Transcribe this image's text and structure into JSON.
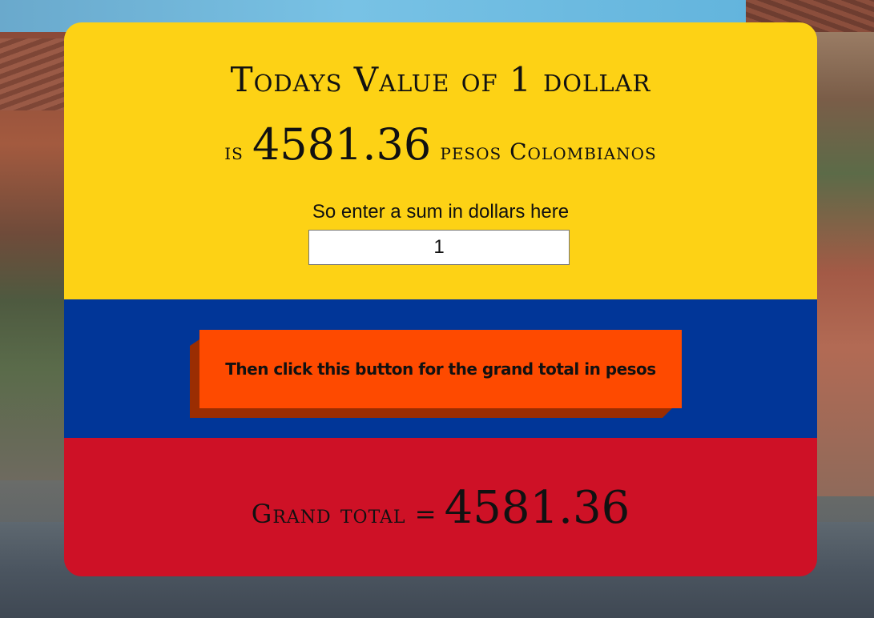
{
  "header": {
    "title": "Todays Value of 1 dollar",
    "rate_prefix": "is",
    "rate_value": "4581.36",
    "rate_suffix": "pesos Colombianos"
  },
  "input_section": {
    "prompt": "So enter a sum in dollars here",
    "amount_value": "1"
  },
  "action": {
    "button_label": "Then click this button for the grand total in pesos"
  },
  "result": {
    "label": "Grand total =",
    "value": "4581.36"
  },
  "colors": {
    "yellow": "#fdd215",
    "blue": "#013698",
    "red": "#ce1126",
    "button": "#fe4a00",
    "button_shadow": "#9a2d02"
  }
}
